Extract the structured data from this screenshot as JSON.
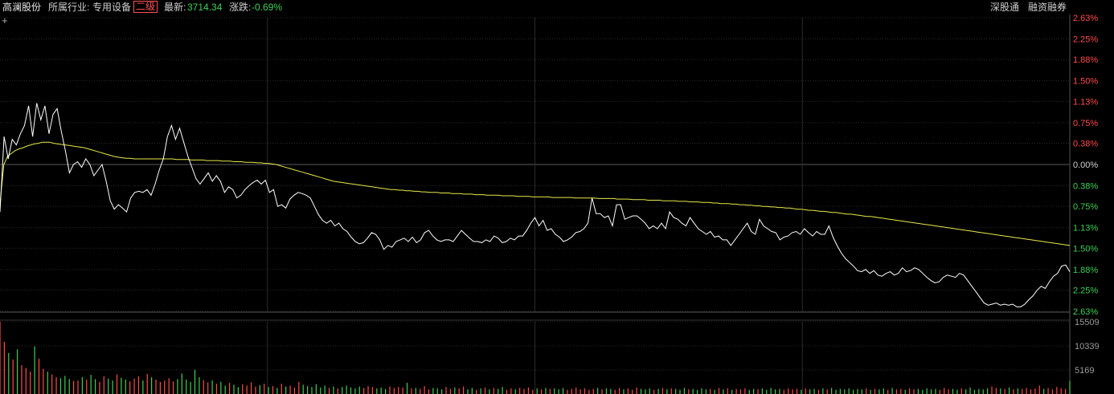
{
  "header": {
    "stock_name": "高澜股份",
    "industry_label": "所属行业:",
    "industry": "专用设备",
    "level_badge": "二级",
    "latest_label": "最新:",
    "latest_value": "3714.34",
    "change_label": "涨跌:",
    "change_value": "-0.69%",
    "link_sgt": "深股通",
    "link_margin": "融资融券"
  },
  "colors": {
    "price_line": "#ffffff",
    "avg_line": "#e8e84a",
    "up": "#ff4a4a",
    "down": "#3ed154",
    "zero": "#cfcfcf",
    "grid": "#2a2a2a"
  },
  "chart_data": [
    {
      "type": "line",
      "title": "",
      "y_unit": "percent",
      "ylim": [
        -2.63,
        2.63
      ],
      "y_tick_values": [
        2.63,
        2.25,
        1.88,
        1.5,
        1.13,
        0.75,
        0.38,
        0,
        -0.38,
        -0.75,
        -1.13,
        -1.5,
        -1.88,
        -2.25,
        -2.63
      ],
      "y_tick_labels": [
        "2.63%",
        "2.25%",
        "1.88%",
        "1.50%",
        "1.13%",
        "0.75%",
        "0.38%",
        "0.00%",
        "0.38%",
        "0.75%",
        "1.13%",
        "1.50%",
        "1.88%",
        "2.25%",
        "2.63%"
      ],
      "grid": true,
      "x_points": 241,
      "series": [
        {
          "role": "price",
          "values": [
            -0.85,
            0.5,
            0.1,
            0.45,
            0.35,
            0.55,
            0.7,
            1.05,
            0.5,
            1.1,
            0.8,
            1.05,
            0.55,
            0.9,
            1.0,
            0.6,
            0.25,
            -0.15,
            0.0,
            0.05,
            -0.05,
            0.1,
            0.0,
            -0.2,
            -0.1,
            0.0,
            -0.3,
            -0.65,
            -0.8,
            -0.72,
            -0.78,
            -0.85,
            -0.6,
            -0.5,
            -0.48,
            -0.5,
            -0.45,
            -0.55,
            -0.35,
            -0.1,
            0.1,
            0.5,
            0.7,
            0.45,
            0.65,
            0.4,
            0.15,
            -0.05,
            -0.25,
            -0.35,
            -0.25,
            -0.15,
            -0.3,
            -0.2,
            -0.3,
            -0.5,
            -0.4,
            -0.45,
            -0.6,
            -0.55,
            -0.45,
            -0.38,
            -0.32,
            -0.28,
            -0.35,
            -0.28,
            -0.5,
            -0.45,
            -0.75,
            -0.72,
            -0.78,
            -0.62,
            -0.55,
            -0.5,
            -0.52,
            -0.55,
            -0.6,
            -0.75,
            -0.9,
            -1.0,
            -1.05,
            -1.0,
            -1.1,
            -1.05,
            -1.15,
            -1.2,
            -1.3,
            -1.38,
            -1.42,
            -1.4,
            -1.32,
            -1.22,
            -1.25,
            -1.35,
            -1.52,
            -1.45,
            -1.48,
            -1.38,
            -1.35,
            -1.32,
            -1.38,
            -1.3,
            -1.4,
            -1.35,
            -1.22,
            -1.18,
            -1.28,
            -1.35,
            -1.38,
            -1.35,
            -1.35,
            -1.38,
            -1.28,
            -1.18,
            -1.25,
            -1.32,
            -1.38,
            -1.38,
            -1.4,
            -1.35,
            -1.38,
            -1.28,
            -1.32,
            -1.4,
            -1.38,
            -1.32,
            -1.35,
            -1.28,
            -1.28,
            -1.18,
            -1.05,
            -0.95,
            -1.1,
            -1.0,
            -1.18,
            -1.15,
            -1.25,
            -1.3,
            -1.38,
            -1.35,
            -1.3,
            -1.22,
            -1.2,
            -1.15,
            -1.05,
            -0.6,
            -0.88,
            -0.88,
            -0.95,
            -0.92,
            -1.1,
            -0.72,
            -0.72,
            -0.98,
            -0.95,
            -0.92,
            -0.92,
            -0.98,
            -1.05,
            -1.15,
            -1.1,
            -1.15,
            -1.05,
            -1.15,
            -0.85,
            -0.95,
            -0.98,
            -1.05,
            -1.1,
            -0.95,
            -1.05,
            -1.15,
            -1.2,
            -1.25,
            -1.2,
            -1.3,
            -1.28,
            -1.35,
            -1.35,
            -1.45,
            -1.35,
            -1.25,
            -1.15,
            -1.05,
            -1.2,
            -1.25,
            -0.98,
            -1.1,
            -1.15,
            -1.2,
            -1.22,
            -1.35,
            -1.3,
            -1.28,
            -1.22,
            -1.2,
            -1.25,
            -1.15,
            -1.22,
            -1.28,
            -1.2,
            -1.25,
            -1.25,
            -1.1,
            -1.3,
            -1.45,
            -1.58,
            -1.68,
            -1.75,
            -1.82,
            -1.9,
            -1.92,
            -1.88,
            -1.95,
            -1.9,
            -1.98,
            -2.0,
            -1.95,
            -1.92,
            -1.98,
            -1.95,
            -1.85,
            -1.92,
            -1.9,
            -1.85,
            -1.88,
            -1.95,
            -2.02,
            -2.08,
            -2.12,
            -2.1,
            -2.02,
            -1.98,
            -2.0,
            -2.02,
            -1.95,
            -1.98,
            -2.08,
            -2.18,
            -2.28,
            -2.38,
            -2.48,
            -2.52,
            -2.5,
            -2.48,
            -2.52,
            -2.5,
            -2.52,
            -2.5,
            -2.55,
            -2.55,
            -2.5,
            -2.42,
            -2.35,
            -2.25,
            -2.18,
            -2.22,
            -2.1,
            -2.0,
            -1.95,
            -1.82,
            -1.8,
            -1.92
          ]
        },
        {
          "role": "average",
          "values": [
            -0.7,
            0.0,
            0.15,
            0.2,
            0.25,
            0.28,
            0.3,
            0.33,
            0.35,
            0.37,
            0.38,
            0.4,
            0.4,
            0.4,
            0.38,
            0.37,
            0.36,
            0.35,
            0.34,
            0.33,
            0.32,
            0.31,
            0.3,
            0.28,
            0.26,
            0.24,
            0.22,
            0.2,
            0.18,
            0.16,
            0.14,
            0.13,
            0.12,
            0.11,
            0.11,
            0.1,
            0.1,
            0.1,
            0.1,
            0.1,
            0.1,
            0.1,
            0.1,
            0.1,
            0.1,
            0.1,
            0.09,
            0.09,
            0.09,
            0.09,
            0.08,
            0.08,
            0.08,
            0.08,
            0.07,
            0.07,
            0.07,
            0.07,
            0.06,
            0.06,
            0.06,
            0.05,
            0.05,
            0.05,
            0.04,
            0.04,
            0.04,
            0.03,
            0.03,
            0.02,
            0.02,
            0.01,
            0.0,
            -0.02,
            -0.04,
            -0.06,
            -0.08,
            -0.1,
            -0.12,
            -0.14,
            -0.16,
            -0.18,
            -0.2,
            -0.22,
            -0.24,
            -0.26,
            -0.28,
            -0.3,
            -0.31,
            -0.32,
            -0.33,
            -0.34,
            -0.35,
            -0.36,
            -0.37,
            -0.38,
            -0.39,
            -0.4,
            -0.41,
            -0.42,
            -0.43,
            -0.44,
            -0.45,
            -0.45,
            -0.46,
            -0.46,
            -0.47,
            -0.47,
            -0.48,
            -0.48,
            -0.49,
            -0.49,
            -0.5,
            -0.5,
            -0.5,
            -0.51,
            -0.51,
            -0.51,
            -0.52,
            -0.52,
            -0.52,
            -0.53,
            -0.53,
            -0.53,
            -0.54,
            -0.54,
            -0.54,
            -0.55,
            -0.55,
            -0.55,
            -0.55,
            -0.56,
            -0.56,
            -0.56,
            -0.56,
            -0.57,
            -0.57,
            -0.57,
            -0.57,
            -0.58,
            -0.58,
            -0.58,
            -0.58,
            -0.58,
            -0.59,
            -0.59,
            -0.59,
            -0.59,
            -0.59,
            -0.59,
            -0.6,
            -0.6,
            -0.6,
            -0.6,
            -0.6,
            -0.6,
            -0.61,
            -0.61,
            -0.61,
            -0.61,
            -0.61,
            -0.62,
            -0.62,
            -0.62,
            -0.62,
            -0.63,
            -0.63,
            -0.63,
            -0.63,
            -0.64,
            -0.64,
            -0.64,
            -0.64,
            -0.65,
            -0.65,
            -0.65,
            -0.65,
            -0.66,
            -0.66,
            -0.66,
            -0.67,
            -0.67,
            -0.67,
            -0.68,
            -0.68,
            -0.68,
            -0.69,
            -0.69,
            -0.7,
            -0.7,
            -0.7,
            -0.71,
            -0.71,
            -0.72,
            -0.72,
            -0.73,
            -0.73,
            -0.74,
            -0.74,
            -0.75,
            -0.75,
            -0.76,
            -0.76,
            -0.77,
            -0.77,
            -0.78,
            -0.78,
            -0.79,
            -0.8,
            -0.8,
            -0.81,
            -0.82,
            -0.82,
            -0.83,
            -0.84,
            -0.84,
            -0.85,
            -0.86,
            -0.86,
            -0.87,
            -0.88,
            -0.89,
            -0.89,
            -0.9,
            -0.91,
            -0.92,
            -0.93,
            -0.93,
            -0.94,
            -0.95,
            -0.96,
            -0.97,
            -0.98,
            -0.99,
            -1.0,
            -1.01,
            -1.02,
            -1.03,
            -1.04,
            -1.05,
            -1.06,
            -1.07,
            -1.08,
            -1.09,
            -1.1,
            -1.11,
            -1.12,
            -1.13,
            -1.14,
            -1.15,
            -1.16,
            -1.17,
            -1.18,
            -1.19,
            -1.2,
            -1.21,
            -1.22,
            -1.23,
            -1.24,
            -1.25,
            -1.26,
            -1.27,
            -1.28,
            -1.29,
            -1.3,
            -1.31,
            -1.32,
            -1.33,
            -1.34,
            -1.35,
            -1.36,
            -1.37,
            -1.38,
            -1.39,
            -1.4,
            -1.41,
            -1.42,
            -1.43,
            -1.44,
            -1.45
          ]
        }
      ]
    },
    {
      "type": "bar",
      "title": "",
      "ylim": [
        0,
        15509
      ],
      "y_tick_labels": [
        "15509",
        "10339",
        "5169"
      ],
      "y_tick_values": [
        15509,
        10339,
        5169
      ],
      "values": [
        15509,
        11200,
        8800,
        7400,
        9600,
        6200,
        5600,
        4800,
        10200,
        7600,
        5400,
        4800,
        4200,
        3600,
        3400,
        3900,
        3200,
        2800,
        2900,
        3600,
        3100,
        4100,
        3200,
        2600,
        3800,
        3300,
        2900,
        4200,
        3500,
        3100,
        2700,
        3300,
        3800,
        2900,
        4300,
        3600,
        3100,
        2600,
        2900,
        3400,
        2700,
        3200,
        4400,
        3100,
        2600,
        5200,
        3600,
        3000,
        2500,
        2900,
        2200,
        2600,
        1800,
        2400,
        2000,
        1500,
        2100,
        1800,
        2500,
        1600,
        1900,
        2200,
        1500,
        1700,
        1300,
        2200,
        1600,
        1800,
        1400,
        2600,
        2000,
        1700,
        1500,
        2100,
        1400,
        1800,
        1300,
        1600,
        1200,
        1500,
        1800,
        1400,
        1200,
        1600,
        1300,
        1700,
        1500,
        1200,
        1400,
        1100,
        1600,
        1300,
        1500,
        1400,
        2400,
        1200,
        1300,
        1100,
        1700,
        1000,
        1300,
        1200,
        1000,
        1500,
        1100,
        1400,
        1200,
        1600,
        1000,
        1300,
        900,
        1200,
        1400,
        1000,
        1300,
        1100,
        1500,
        900,
        1200,
        1000,
        1300,
        1100,
        1400,
        900,
        1200,
        1000,
        1300,
        1100,
        1200,
        1000,
        1300,
        900,
        1100,
        1400,
        1000,
        1200,
        900,
        1100,
        1300,
        1000,
        1200,
        1100,
        900,
        1300,
        1000,
        1200,
        900,
        1400,
        1100,
        1000,
        1200,
        900,
        1100,
        1300,
        1000,
        1200,
        1100,
        900,
        1300,
        1000,
        1100,
        900,
        1200,
        1000,
        1100,
        900,
        1300,
        1000,
        1200,
        900,
        1100,
        1000,
        1200,
        900,
        1100,
        1000,
        1200,
        900,
        1300,
        1000,
        1100,
        900,
        1200,
        1000,
        1100,
        900,
        1200,
        1000,
        1100,
        900,
        1200,
        1000,
        1300,
        900,
        1100,
        1000,
        1200,
        900,
        1100,
        1000,
        1200,
        900,
        1100,
        1000,
        1200,
        900,
        1300,
        1000,
        1100,
        900,
        1200,
        1000,
        1100,
        900,
        1200,
        1000,
        1100,
        900,
        1300,
        1000,
        1100,
        900,
        1200,
        1000,
        1400,
        900,
        1100,
        1000,
        1200,
        1600,
        1300,
        1200,
        1100,
        1400,
        1000,
        1200,
        1100,
        1300,
        1000,
        1200,
        1800,
        1100,
        1300,
        1000,
        1500,
        1200,
        1100,
        2800
      ]
    }
  ]
}
